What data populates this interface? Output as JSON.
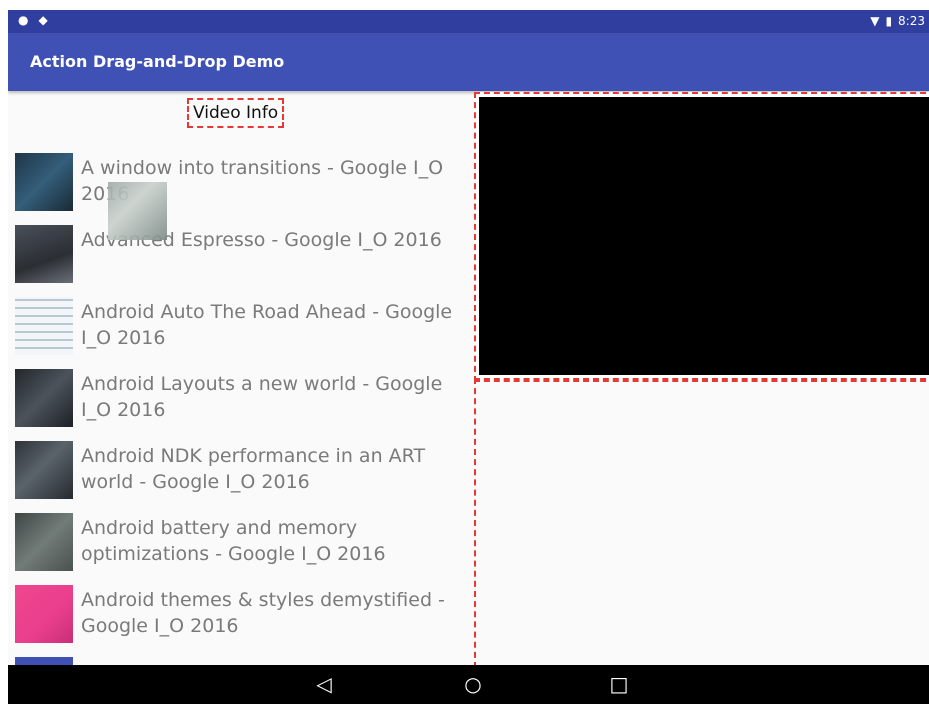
{
  "status_bar": {
    "time": "8:23",
    "left_icons": [
      "drop-icon",
      "android-icon"
    ],
    "right_icons": [
      "wifi-icon",
      "battery-icon"
    ]
  },
  "app_bar": {
    "title": "Action Drag-and-Drop Demo",
    "color": "#3f51b5"
  },
  "video_info": {
    "label": "Video Info"
  },
  "videos": [
    {
      "title": "A window into transitions - Google I_O 2016",
      "thumb_color": "#2f4f66"
    },
    {
      "title": "Advanced Espresso - Google I_O 2016",
      "thumb_color": "#3b3f46"
    },
    {
      "title": "Android Auto The Road Ahead - Google I_O 2016",
      "thumb_color": "#e9eef2"
    },
    {
      "title": "Android Layouts a new world - Google I_O 2016",
      "thumb_color": "#31363d"
    },
    {
      "title": "Android NDK performance in an ART world - Google I_O 2016",
      "thumb_color": "#3a4046"
    },
    {
      "title": "Android battery and memory optimizations - Google I_O 2016",
      "thumb_color": "#58605e"
    },
    {
      "title": "Android themes & styles demystified - Google I_O 2016",
      "thumb_color": "#e83e8c"
    }
  ],
  "navigation": {
    "back": "◁",
    "home": "○",
    "recents": "□"
  }
}
